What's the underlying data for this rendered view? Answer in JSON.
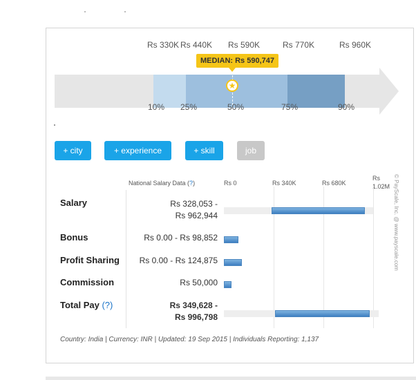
{
  "percentile_chart": {
    "top_labels": [
      "Rs 330K",
      "Rs 440K",
      "Rs 590K",
      "Rs 770K",
      "Rs 960K"
    ],
    "bottom_labels": [
      "10%",
      "25%",
      "50%",
      "75%",
      "90%"
    ],
    "median_label": "MEDIAN: Rs 590,747",
    "colors": {
      "p10_25": "#c3dbee",
      "p25_75": "#9dbfde",
      "p50_75": "#9dbfde",
      "p75_90": "#769fc4",
      "track": "#e6e6e6",
      "median": "#f5c518"
    }
  },
  "filters": {
    "city": "+ city",
    "experience": "+ experience",
    "skill": "+ skill",
    "job": "job"
  },
  "table": {
    "header_title": "National Salary Data (",
    "header_q": "?",
    "header_close": ")",
    "axis": [
      "Rs 0",
      "Rs 340K",
      "Rs 680K",
      "Rs",
      "1.02M"
    ],
    "rows": [
      {
        "label": "Salary",
        "value_line1": "Rs 328,053 -",
        "value_line2": "Rs 962,944",
        "range": [
          328053,
          962944
        ]
      },
      {
        "label": "Bonus",
        "value_line1": "Rs 0.00 - Rs 98,852",
        "range": [
          0,
          98852
        ]
      },
      {
        "label": "Profit Sharing",
        "value_line1": "Rs 0.00 - Rs 124,875",
        "range": [
          0,
          124875
        ]
      },
      {
        "label": "Commission",
        "value_line1": "Rs 50,000",
        "range": [
          0,
          50000
        ]
      },
      {
        "label": "Total Pay",
        "label_q": "(?)",
        "value_line1": "Rs 349,628 -",
        "value_line2": "Rs 996,798",
        "range": [
          349628,
          996798
        ]
      }
    ]
  },
  "footer": "Country: India | Currency: INR | Updated: 19 Sep 2015 | Individuals Reporting: 1,137",
  "copyright": "© PayScale, Inc. @ www.payscale.com"
}
